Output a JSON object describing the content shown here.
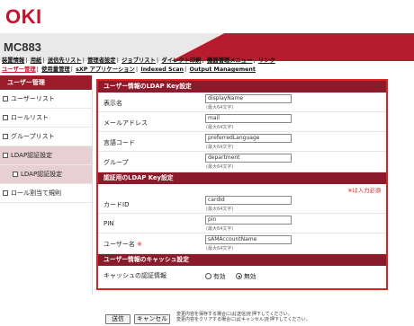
{
  "header": {
    "logo": "OKI",
    "model": "MC883",
    "brand_color": "#c8102e"
  },
  "menu": {
    "row1": [
      "装置情報",
      "用紙",
      "送信先リスト",
      "管理者設定",
      "ジョブリスト",
      "ダイレクト印刷",
      "機器管理メニュー",
      "リンク"
    ],
    "row2": [
      "ユーザー管理",
      "使用量管理",
      "sXP アプリケーション",
      "Indexed Scan",
      "Output Management"
    ]
  },
  "sidebar": {
    "title": "ユーザー管理",
    "items": [
      {
        "label": "ユーザーリスト"
      },
      {
        "label": "ロールリスト"
      },
      {
        "label": "グループリスト"
      },
      {
        "label": "LDAP認証設定"
      },
      {
        "label": "LDAP認証設定"
      },
      {
        "label": "ロール割当て規則"
      }
    ]
  },
  "ldap_key": {
    "title": "ユーザー情報のLDAP Key設定",
    "rows": [
      {
        "label": "表示名",
        "value": "displayName",
        "hint": "(最大64文字)"
      },
      {
        "label": "メールアドレス",
        "value": "mail",
        "hint": "(最大64文字)"
      },
      {
        "label": "言語コード",
        "value": "preferredLanguage",
        "hint": "(最大64文字)"
      },
      {
        "label": "グループ",
        "value": "department",
        "hint": "(最大64文字)"
      }
    ]
  },
  "auth_key": {
    "title": "認証用のLDAP Key設定",
    "required_note": "※は入力必須",
    "rows": [
      {
        "label": "カードID",
        "value": "cardId",
        "hint": "(最大64文字)"
      },
      {
        "label": "PIN",
        "value": "pin",
        "hint": "(最大64文字)"
      },
      {
        "label": "ユーザー名",
        "required_mark": "※",
        "value": "sAMAccountName",
        "hint": "(最大64文字)"
      }
    ]
  },
  "cache": {
    "title": "ユーザー情報のキャッシュ設定",
    "label": "キャッシュの認証情報",
    "options": [
      "有効",
      "無効"
    ],
    "selected": "無効"
  },
  "buttons": {
    "submit": "送信",
    "cancel": "キャンセル"
  },
  "note": {
    "line1": "変更内容を保存する場合には[送信]を押下してください。",
    "line2": "変更内容をクリアする場合には[キャンセル]を押下してください。"
  }
}
